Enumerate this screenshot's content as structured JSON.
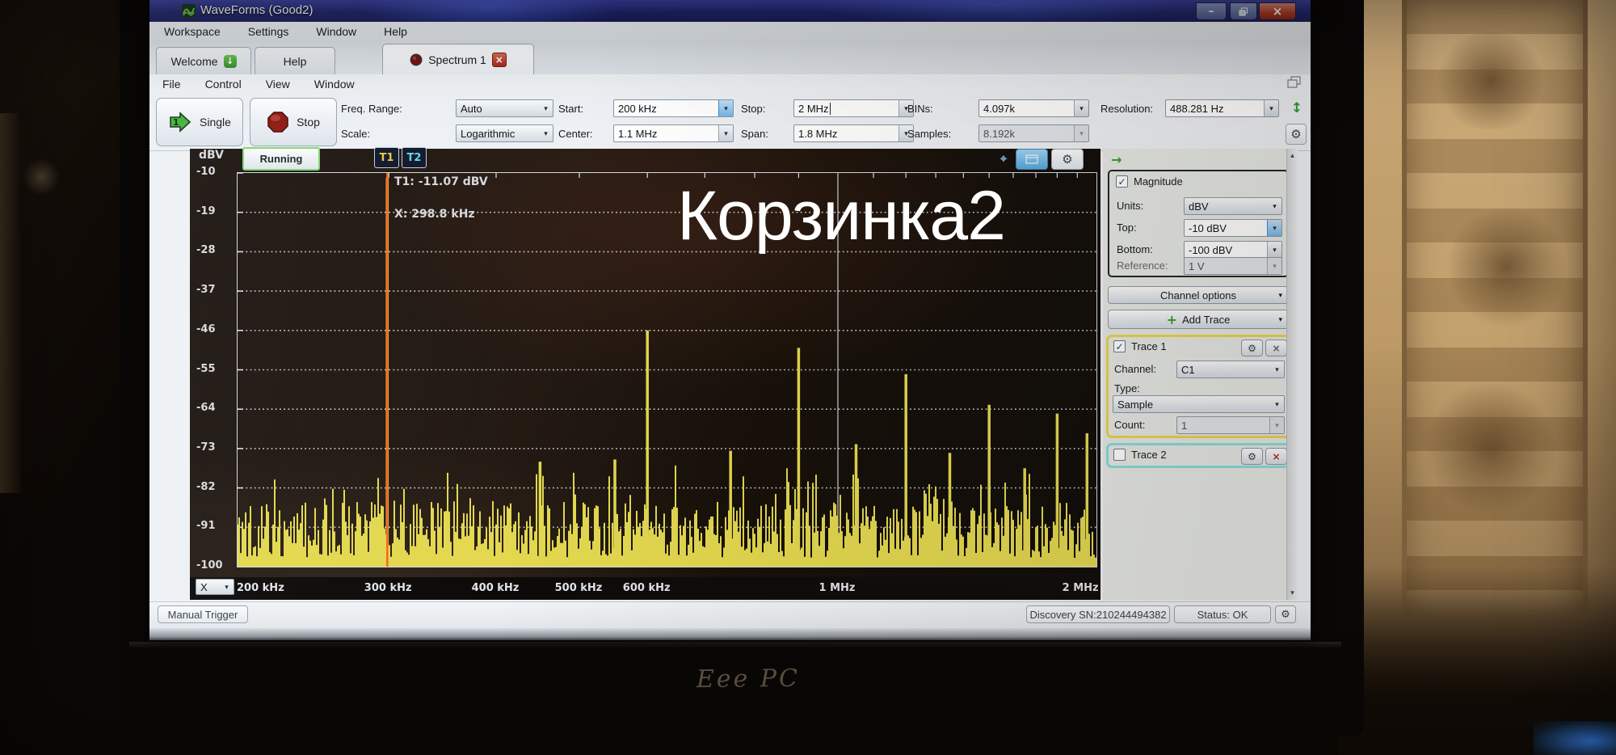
{
  "window": {
    "title": "WaveForms  (Good2)"
  },
  "menu_top": {
    "items": [
      "Workspace",
      "Settings",
      "Window",
      "Help"
    ]
  },
  "tabs": {
    "welcome": "Welcome",
    "help": "Help",
    "spectrum": "Spectrum 1"
  },
  "menu_doc": {
    "items": [
      "File",
      "Control",
      "View",
      "Window"
    ]
  },
  "toolbar": {
    "single": "Single",
    "stop": "Stop",
    "freq_range_label": "Freq. Range:",
    "freq_range": "Auto",
    "scale_label": "Scale:",
    "scale": "Logarithmic",
    "start_label": "Start:",
    "start": "200 kHz",
    "center_label": "Center:",
    "center": "1.1 MHz",
    "stop_label": "Stop:",
    "stop_value": "2 MHz",
    "span_label": "Span:",
    "span": "1.8 MHz",
    "bins_label": "BINs:",
    "bins": "4.097k",
    "samples_label": "Samples:",
    "samples": "8.192k",
    "resolution_label": "Resolution:",
    "resolution": "488.281 Hz"
  },
  "plot": {
    "status": "Running",
    "y_unit": "dBV",
    "t1_tab": "T1",
    "t2_tab": "T2",
    "marker_value_readout": "T1: -11.07 dBV",
    "marker_x_readout": "X: 298.8 kHz",
    "x_axis_selector": "X"
  },
  "side_panel": {
    "magnitude": {
      "label": "Magnitude",
      "checked": true,
      "units_label": "Units:",
      "units": "dBV",
      "top_label": "Top:",
      "top": "-10 dBV",
      "bottom_label": "Bottom:",
      "bottom": "-100 dBV",
      "reference_label": "Reference:",
      "reference": "1 V"
    },
    "channel_options": "Channel options",
    "add_trace": "Add Trace",
    "trace1": {
      "label": "Trace 1",
      "checked": true,
      "channel_label": "Channel:",
      "channel": "C1",
      "type_label": "Type:",
      "type": "Sample",
      "count_label": "Count:",
      "count": "1"
    },
    "trace2": {
      "label": "Trace 2",
      "checked": false
    }
  },
  "status_bar": {
    "manual_trigger": "Manual Trigger",
    "device": "Discovery SN:210244494382",
    "status": "Status: OK"
  },
  "overlay": {
    "caption": "Корзинка2"
  },
  "laptop": {
    "logo": "Eee PC"
  },
  "icons": {
    "combo_arrow": "▾",
    "check": "✓",
    "gear": "⚙",
    "close_x": "×",
    "minimize": "–",
    "plus": "+",
    "arrow_right": "→",
    "arrow_down": "↓",
    "updown": "↕",
    "scroll_up": "▴",
    "scroll_down": "▾",
    "cursor": "⌖"
  },
  "colors": {
    "trace": "#e3d84f",
    "marker": "#ff5c1a",
    "grid": "#e8ecf2",
    "trace1_border": "#e9d34b",
    "trace2_border": "#86dcd8",
    "titlebar": "#20266f",
    "close_button": "#b23a24"
  },
  "chart_data": {
    "type": "line",
    "title": "Spectrum 1 — C1 magnitude spectrum",
    "x_scale": "log",
    "x_unit": "Hz",
    "xlim_hz": [
      200000,
      2000000
    ],
    "x_ticks": [
      {
        "hz": 200000,
        "label": "200 kHz"
      },
      {
        "hz": 300000,
        "label": "300 kHz"
      },
      {
        "hz": 400000,
        "label": "400 kHz"
      },
      {
        "hz": 500000,
        "label": "500 kHz"
      },
      {
        "hz": 600000,
        "label": "600 kHz"
      },
      {
        "hz": 1000000,
        "label": "1 MHz"
      },
      {
        "hz": 2000000,
        "label": "2 MHz"
      }
    ],
    "x_minor_ticks_hz": [
      300000,
      400000,
      500000,
      600000,
      700000,
      800000,
      900000,
      1100000,
      1200000,
      1300000,
      1400000,
      1500000,
      1600000,
      1700000,
      1800000,
      1900000
    ],
    "y_unit": "dBV",
    "ylim": [
      -100,
      -10
    ],
    "y_ticks": [
      -10,
      -19,
      -28,
      -37,
      -46,
      -55,
      -64,
      -73,
      -82,
      -91,
      -100
    ],
    "v_gridline_hz": 1000000,
    "grid": {
      "horizontal": "dotted",
      "vertical": "solid at 1 MHz"
    },
    "trace": {
      "name": "Trace 1",
      "channel": "C1",
      "type": "Sample",
      "color": "#e3d84f"
    },
    "noise_floor_dbv": {
      "min": -100,
      "typical": -90,
      "max": -74
    },
    "peaks": [
      {
        "hz": 298800,
        "dbv": -11.07,
        "marker": "T1"
      },
      {
        "hz": 450000,
        "dbv": -76
      },
      {
        "hz": 550000,
        "dbv": -75.5
      },
      {
        "hz": 600000,
        "dbv": -46
      },
      {
        "hz": 750000,
        "dbv": -73.5
      },
      {
        "hz": 900000,
        "dbv": -50
      },
      {
        "hz": 1050000,
        "dbv": -72
      },
      {
        "hz": 1200000,
        "dbv": -56
      },
      {
        "hz": 1350000,
        "dbv": -74
      },
      {
        "hz": 1500000,
        "dbv": -63
      },
      {
        "hz": 1650000,
        "dbv": -77.5
      },
      {
        "hz": 1800000,
        "dbv": -65
      },
      {
        "hz": 1950000,
        "dbv": -69.5
      }
    ],
    "marker": {
      "name": "T1",
      "x_hz": 298800,
      "value_dbv": -11.07,
      "value_label": "T1: -11.07 dBV",
      "x_label": "X: 298.8 kHz",
      "color": "#ff5c1a"
    },
    "legend": null
  }
}
